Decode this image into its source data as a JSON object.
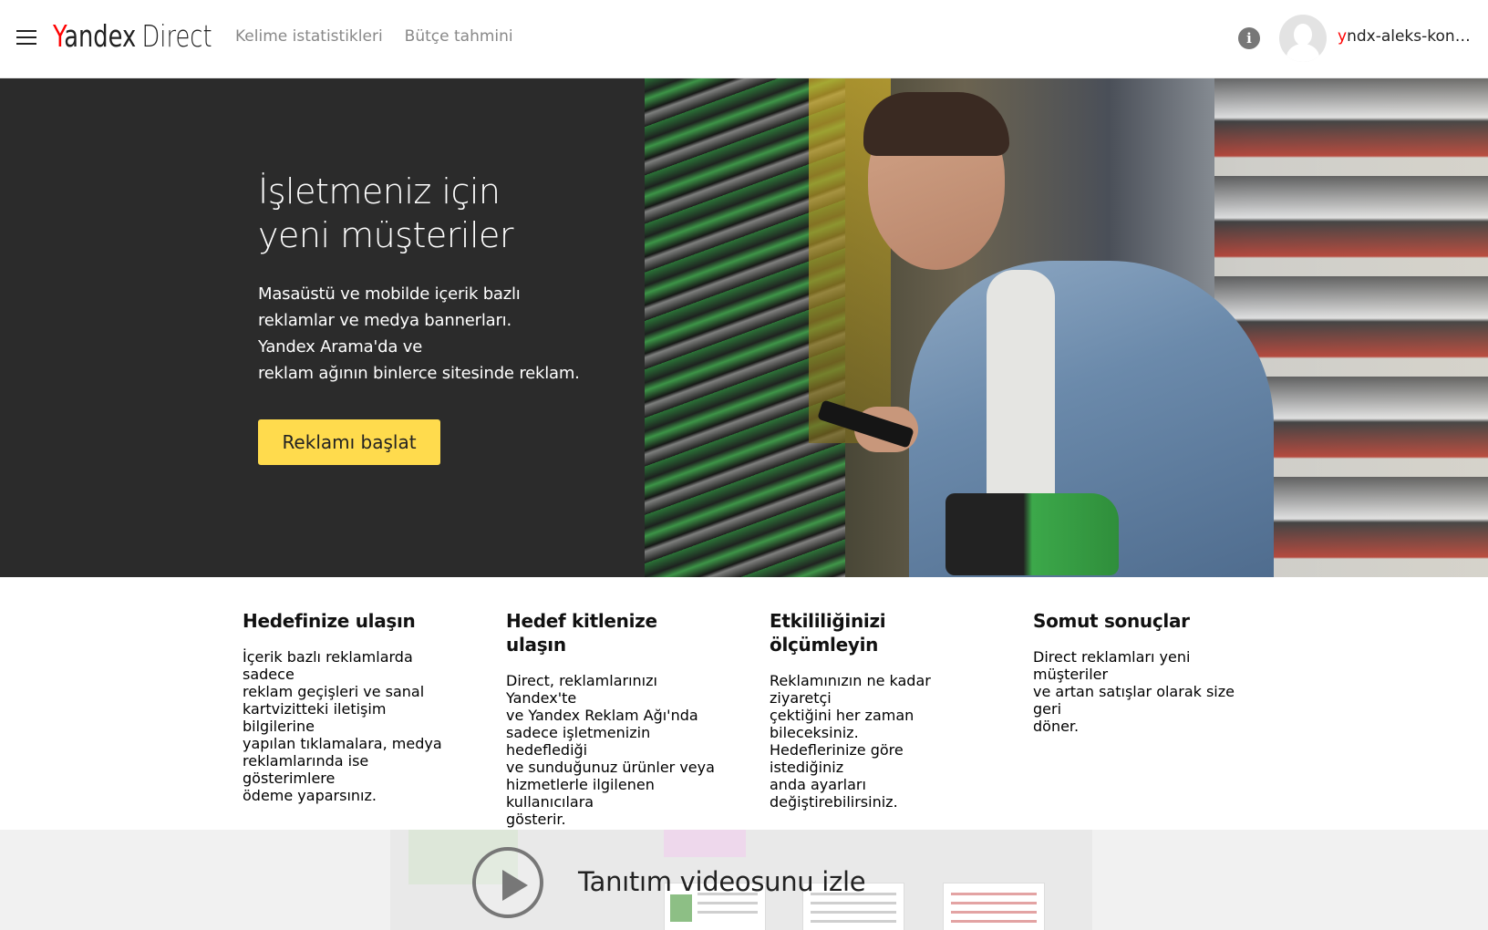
{
  "header": {
    "logo_y": "Y",
    "logo_andex": "andex",
    "logo_direct": "Direct",
    "nav": [
      "Kelime istatistikleri",
      "Bütçe tahmini"
    ],
    "info_icon": "i",
    "username_first": "y",
    "username_rest": "ndx-aleks-kons..."
  },
  "hero": {
    "title_lines": [
      "İşletmeniz için",
      "yeni müşteriler"
    ],
    "desc_lines": [
      "Masaüstü ve mobilde içerik bazlı",
      "reklamlar ve medya bannerları.",
      "Yandex Arama'da ve",
      "reklam ağının binlerce sitesinde reklam."
    ],
    "cta_label": "Reklamı başlat"
  },
  "features": [
    {
      "title_lines": [
        "Hedefinize ulaşın"
      ],
      "text_lines": [
        "İçerik bazlı reklamlarda sadece",
        "reklam geçişleri ve sanal",
        "kartvizitteki iletişim bilgilerine",
        "yapılan tıklamalara, medya",
        "reklamlarında ise gösterimlere",
        "ödeme yaparsınız."
      ]
    },
    {
      "title_lines": [
        "Hedef kitlenize",
        "ulaşın"
      ],
      "text_lines": [
        "Direct, reklamlarınızı Yandex'te",
        "ve Yandex Reklam Ağı'nda",
        "sadece işletmenizin hedeflediği",
        "ve sunduğunuz ürünler veya",
        "hizmetlerle ilgilenen kullanıcılara",
        "gösterir."
      ]
    },
    {
      "title_lines": [
        "Etkililiğinizi",
        "ölçümleyin"
      ],
      "text_lines": [
        "Reklamınızın ne kadar ziyaretçi",
        "çektiğini her zaman bileceksiniz.",
        "Hedeflerinize göre istediğiniz",
        "anda ayarları değiştirebilirsiniz."
      ]
    },
    {
      "title_lines": [
        "Somut sonuçlar"
      ],
      "text_lines": [
        "Direct reklamları yeni müşteriler",
        "ve artan satışlar olarak size geri",
        "döner."
      ]
    }
  ],
  "video": {
    "label": "Tanıtım videosunu izle"
  },
  "colors": {
    "accent_yellow": "#ffdb4d",
    "brand_red": "#ff0000",
    "hero_dark": "#2b2b2b"
  },
  "icons": {
    "menu": "hamburger-icon",
    "info": "info-icon",
    "avatar": "user-avatar-icon",
    "play": "play-icon"
  }
}
